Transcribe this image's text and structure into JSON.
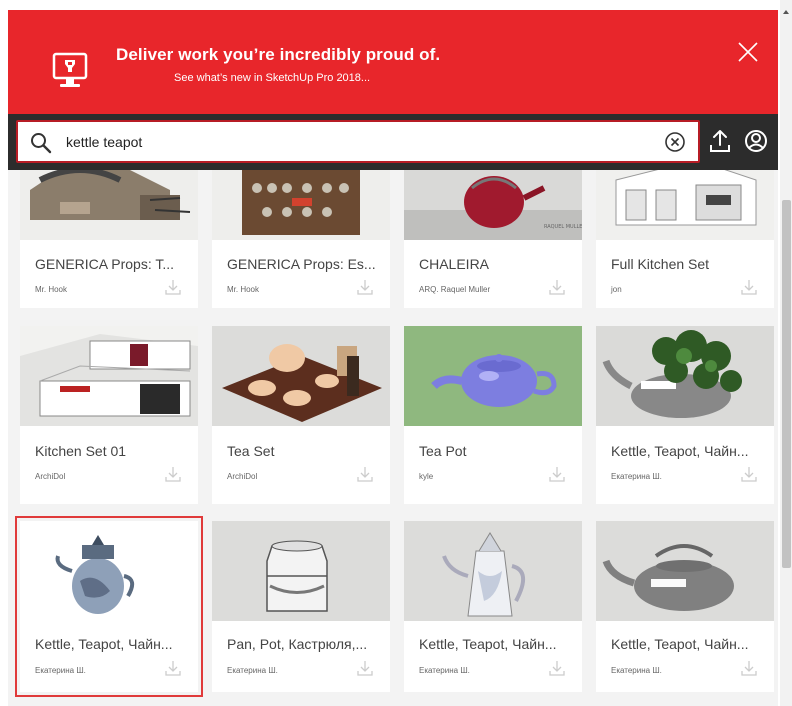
{
  "banner": {
    "title": "Deliver work you’re incredibly proud of.",
    "subtitle": "See what’s new in SketchUp Pro 2018...",
    "icon": "monitor-icon",
    "close_icon": "close-icon",
    "color": "#e8262b"
  },
  "search": {
    "value": "kettle teapot",
    "icon": "search-icon",
    "clear_icon": "clear-icon"
  },
  "toolbar": {
    "upload_icon": "upload-icon",
    "account_icon": "account-icon"
  },
  "models": [
    {
      "name": "GENERICA Props: T...",
      "author": "Mr. Hook"
    },
    {
      "name": "GENERICA Props: Es...",
      "author": "Mr. Hook"
    },
    {
      "name": "CHALEIRA",
      "author": "ARQ. Raquel Muller"
    },
    {
      "name": "Full Kitchen Set",
      "author": "jon"
    },
    {
      "name": "Kitchen Set 01",
      "author": "ArchiDol"
    },
    {
      "name": "Tea Set",
      "author": "ArchiDol"
    },
    {
      "name": "Tea Pot",
      "author": "kyle"
    },
    {
      "name": "Kettle, Teapot, Чайн...",
      "author": "Екатерина Ш."
    },
    {
      "name": "Kettle, Teapot, Чайн...",
      "author": "Екатерина Ш."
    },
    {
      "name": "Pan, Pot, Кастрюля,...",
      "author": "Екатерина Ш."
    },
    {
      "name": "Kettle, Teapot, Чайн...",
      "author": "Екатерина Ш."
    },
    {
      "name": "Kettle, Teapot, Чайн...",
      "author": "Екатерина Ш."
    }
  ],
  "selected_model": "Kettle, Teapot, Чайн... (Екатерина Ш.), row 3 column 1"
}
